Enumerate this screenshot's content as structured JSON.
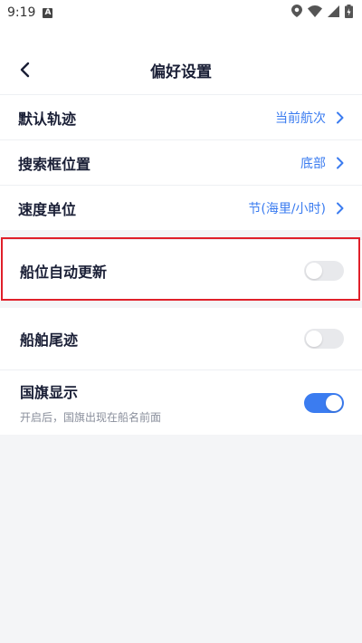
{
  "status_bar": {
    "time": "9:19",
    "badge": "A"
  },
  "header": {
    "title": "偏好设置"
  },
  "nav_settings": [
    {
      "label": "默认轨迹",
      "value": "当前航次"
    },
    {
      "label": "搜索框位置",
      "value": "底部"
    },
    {
      "label": "速度单位",
      "value": "节(海里/小时)"
    }
  ],
  "toggles": [
    {
      "label": "船位自动更新",
      "sub": "",
      "on": false
    },
    {
      "label": "船舶尾迹",
      "sub": "",
      "on": false
    },
    {
      "label": "国旗显示",
      "sub": "开启后，国旗出现在船名前面",
      "on": true
    }
  ],
  "colors": {
    "accent": "#3b7cf0",
    "highlight": "#e0202a"
  }
}
